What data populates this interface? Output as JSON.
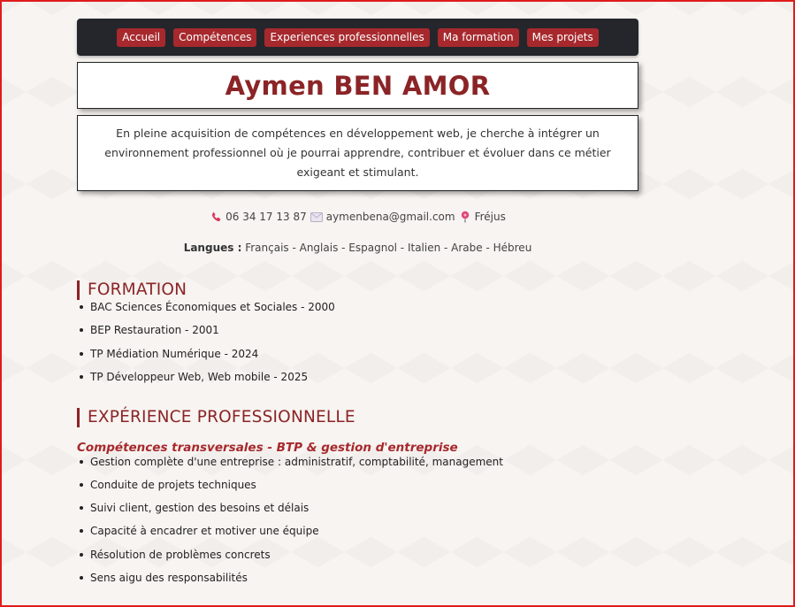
{
  "nav": {
    "items": [
      {
        "label": "Accueil"
      },
      {
        "label": "Compétences"
      },
      {
        "label": "Experiences professionnelles"
      },
      {
        "label": "Ma formation"
      },
      {
        "label": "Mes projets"
      }
    ]
  },
  "header": {
    "name": "Aymen BEN AMOR",
    "intro": "En pleine acquisition de compétences en développement web, je cherche à intégrer un environnement professionnel où je pourrai apprendre, contribuer et évoluer dans ce métier exigeant et stimulant."
  },
  "contact": {
    "phone_icon": "phone-icon",
    "phone": "06 34 17 13 87",
    "email_icon": "envelope-icon",
    "email": "aymenbena@gmail.com",
    "location_icon": "pin-icon",
    "location": "Fréjus"
  },
  "languages": {
    "label": "Langues :",
    "value": "Français - Anglais - Espagnol - Italien - Arabe - Hébreu"
  },
  "formation": {
    "title": "FORMATION",
    "items": [
      "BAC Sciences Économiques et Sociales - 2000",
      "BEP Restauration - 2001",
      "TP Médiation Numérique - 2024",
      "TP Développeur Web, Web mobile - 2025"
    ]
  },
  "experience": {
    "title": "EXPÉRIENCE PROFESSIONNELLE",
    "subtitle": "Compétences transversales - BTP & gestion d'entreprise",
    "items": [
      "Gestion complète d'une entreprise : administratif, comptabilité, management",
      "Conduite de projets techniques",
      "Suivi client, gestion des besoins et délais",
      "Capacité à encadrer et motiver une équipe",
      "Résolution de problèmes concrets",
      "Sens aigu des responsabilités"
    ]
  },
  "colors": {
    "accent": "#a7292d",
    "title": "#8b2426",
    "navbar": "#24262b"
  }
}
